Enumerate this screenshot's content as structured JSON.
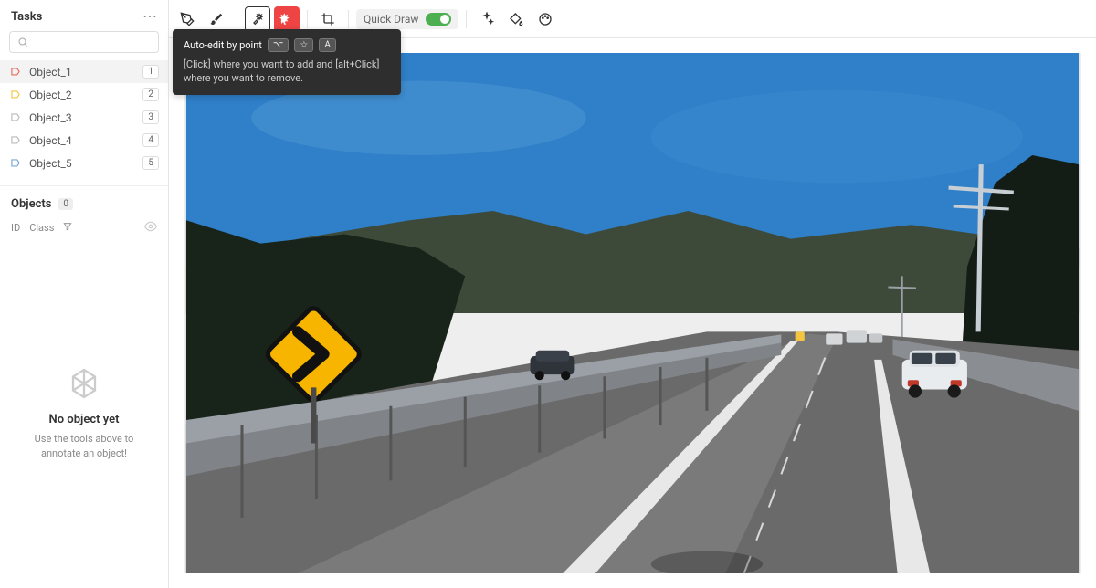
{
  "sidebar": {
    "title": "Tasks",
    "search_placeholder": "",
    "tasks": [
      {
        "label": "Object_1",
        "badge": "1",
        "color": "#e86c60"
      },
      {
        "label": "Object_2",
        "badge": "2",
        "color": "#f2c744"
      },
      {
        "label": "Object_3",
        "badge": "3",
        "color": "#999"
      },
      {
        "label": "Object_4",
        "badge": "4",
        "color": "#999"
      },
      {
        "label": "Object_5",
        "badge": "5",
        "color": "#7aa7d9"
      }
    ]
  },
  "objects_panel": {
    "title": "Objects",
    "count": "0",
    "cols": {
      "id": "ID",
      "class": "Class"
    },
    "empty_title": "No object yet",
    "empty_sub": "Use the tools above to annotate an object!"
  },
  "toolbar": {
    "quick_draw_label": "Quick Draw"
  },
  "tooltip": {
    "title": "Auto-edit by point",
    "keys": [
      "⌥",
      "☆",
      "A"
    ],
    "body": "[Click] where you want to add and [alt+Click] where you want to remove."
  }
}
